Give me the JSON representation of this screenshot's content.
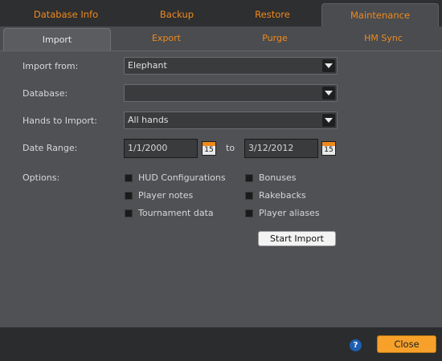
{
  "top_tabs": [
    {
      "label": "Database Info",
      "active": false
    },
    {
      "label": "Backup",
      "active": false
    },
    {
      "label": "Restore",
      "active": false
    },
    {
      "label": "Maintenance",
      "active": true
    }
  ],
  "sub_tabs": [
    {
      "label": "Import",
      "active": true
    },
    {
      "label": "Export",
      "active": false
    },
    {
      "label": "Purge",
      "active": false
    },
    {
      "label": "HM Sync",
      "active": false
    }
  ],
  "form": {
    "import_from": {
      "label": "Import from:",
      "value": "Elephant"
    },
    "database": {
      "label": "Database:",
      "value": ""
    },
    "hands_to_import": {
      "label": "Hands to Import:",
      "value": "All hands"
    },
    "date_range": {
      "label": "Date Range:",
      "from": "1/1/2000",
      "to_label": "to",
      "to": "3/12/2012",
      "calendar_day": "15"
    },
    "options_label": "Options:",
    "options": [
      {
        "label": "HUD Configurations",
        "checked": false
      },
      {
        "label": "Bonuses",
        "checked": false
      },
      {
        "label": "Player notes",
        "checked": false
      },
      {
        "label": "Rakebacks",
        "checked": false
      },
      {
        "label": "Tournament data",
        "checked": false
      },
      {
        "label": "Player aliases",
        "checked": false
      }
    ],
    "start_button": "Start Import"
  },
  "footer": {
    "help_symbol": "?",
    "close_button": "Close"
  },
  "colors": {
    "accent": "#f08a1c",
    "close_button": "#f7a12a",
    "panel": "#4f5154",
    "help_icon": "#1d5fb3"
  }
}
